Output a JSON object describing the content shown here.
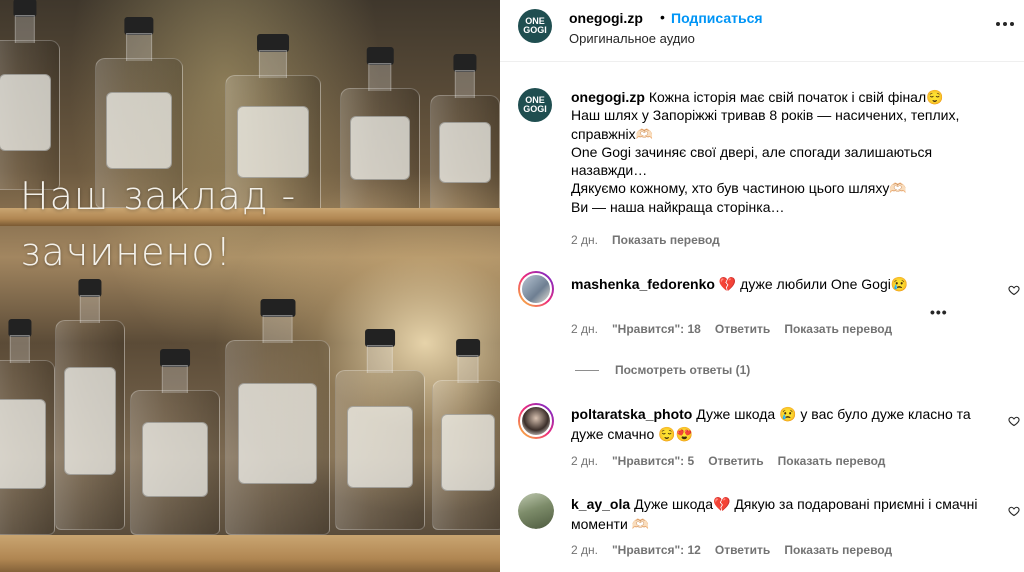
{
  "media": {
    "overlay_line1": "Наш заклад -",
    "overlay_line2": "зачинено!"
  },
  "header": {
    "logo_line1": "ONE",
    "logo_line2": "GOGI",
    "username": "onegogi.zp",
    "separator": "•",
    "follow_label": "Подписаться",
    "audio_label": "Оригинальное аудио"
  },
  "caption": {
    "logo_line1": "ONE",
    "logo_line2": "GOGI",
    "username": "onegogi.zp",
    "lines": [
      "Кожна історія має свій початок і свій фінал😌",
      "Наш шлях у Запоріжжі тривав 8 років — насичених, теплих, справжніх🫶🏻",
      "One Gogi зачиняє свої двері, але спогади залишаються назавжди…",
      "Дякуємо кожному, хто був частиною цього шляху🫶🏻",
      "Ви — наша найкраща сторінка…"
    ],
    "time": "2 дн.",
    "translate_label": "Показать перевод"
  },
  "comments": [
    {
      "username": "mashenka_fedorenko",
      "text": "💔 дуже любили One Gogi😢",
      "time": "2 дн.",
      "likes": "\"Нравится\": 18",
      "reply_label": "Ответить",
      "translate_label": "Показать перевод",
      "more_label": "•••",
      "view_replies_label": "Посмотреть ответы (1)"
    },
    {
      "username": "poltaratska_photo",
      "text": "Дуже шкода 😢 у вас було дуже класно та дуже смачно 😌😍",
      "time": "2 дн.",
      "likes": "\"Нравится\": 5",
      "reply_label": "Ответить",
      "translate_label": "Показать перевод"
    },
    {
      "username": "k_ay_ola",
      "text": "Дуже шкода💔 Дякую за подаровані приємні і смачні моменти 🫶🏻",
      "time": "2 дн.",
      "likes": "\"Нравится\": 12",
      "reply_label": "Ответить",
      "translate_label": "Показать перевод"
    }
  ],
  "colors": {
    "accent": "#0095f6",
    "logo_bg": "#1f4e50",
    "muted": "#737373"
  }
}
